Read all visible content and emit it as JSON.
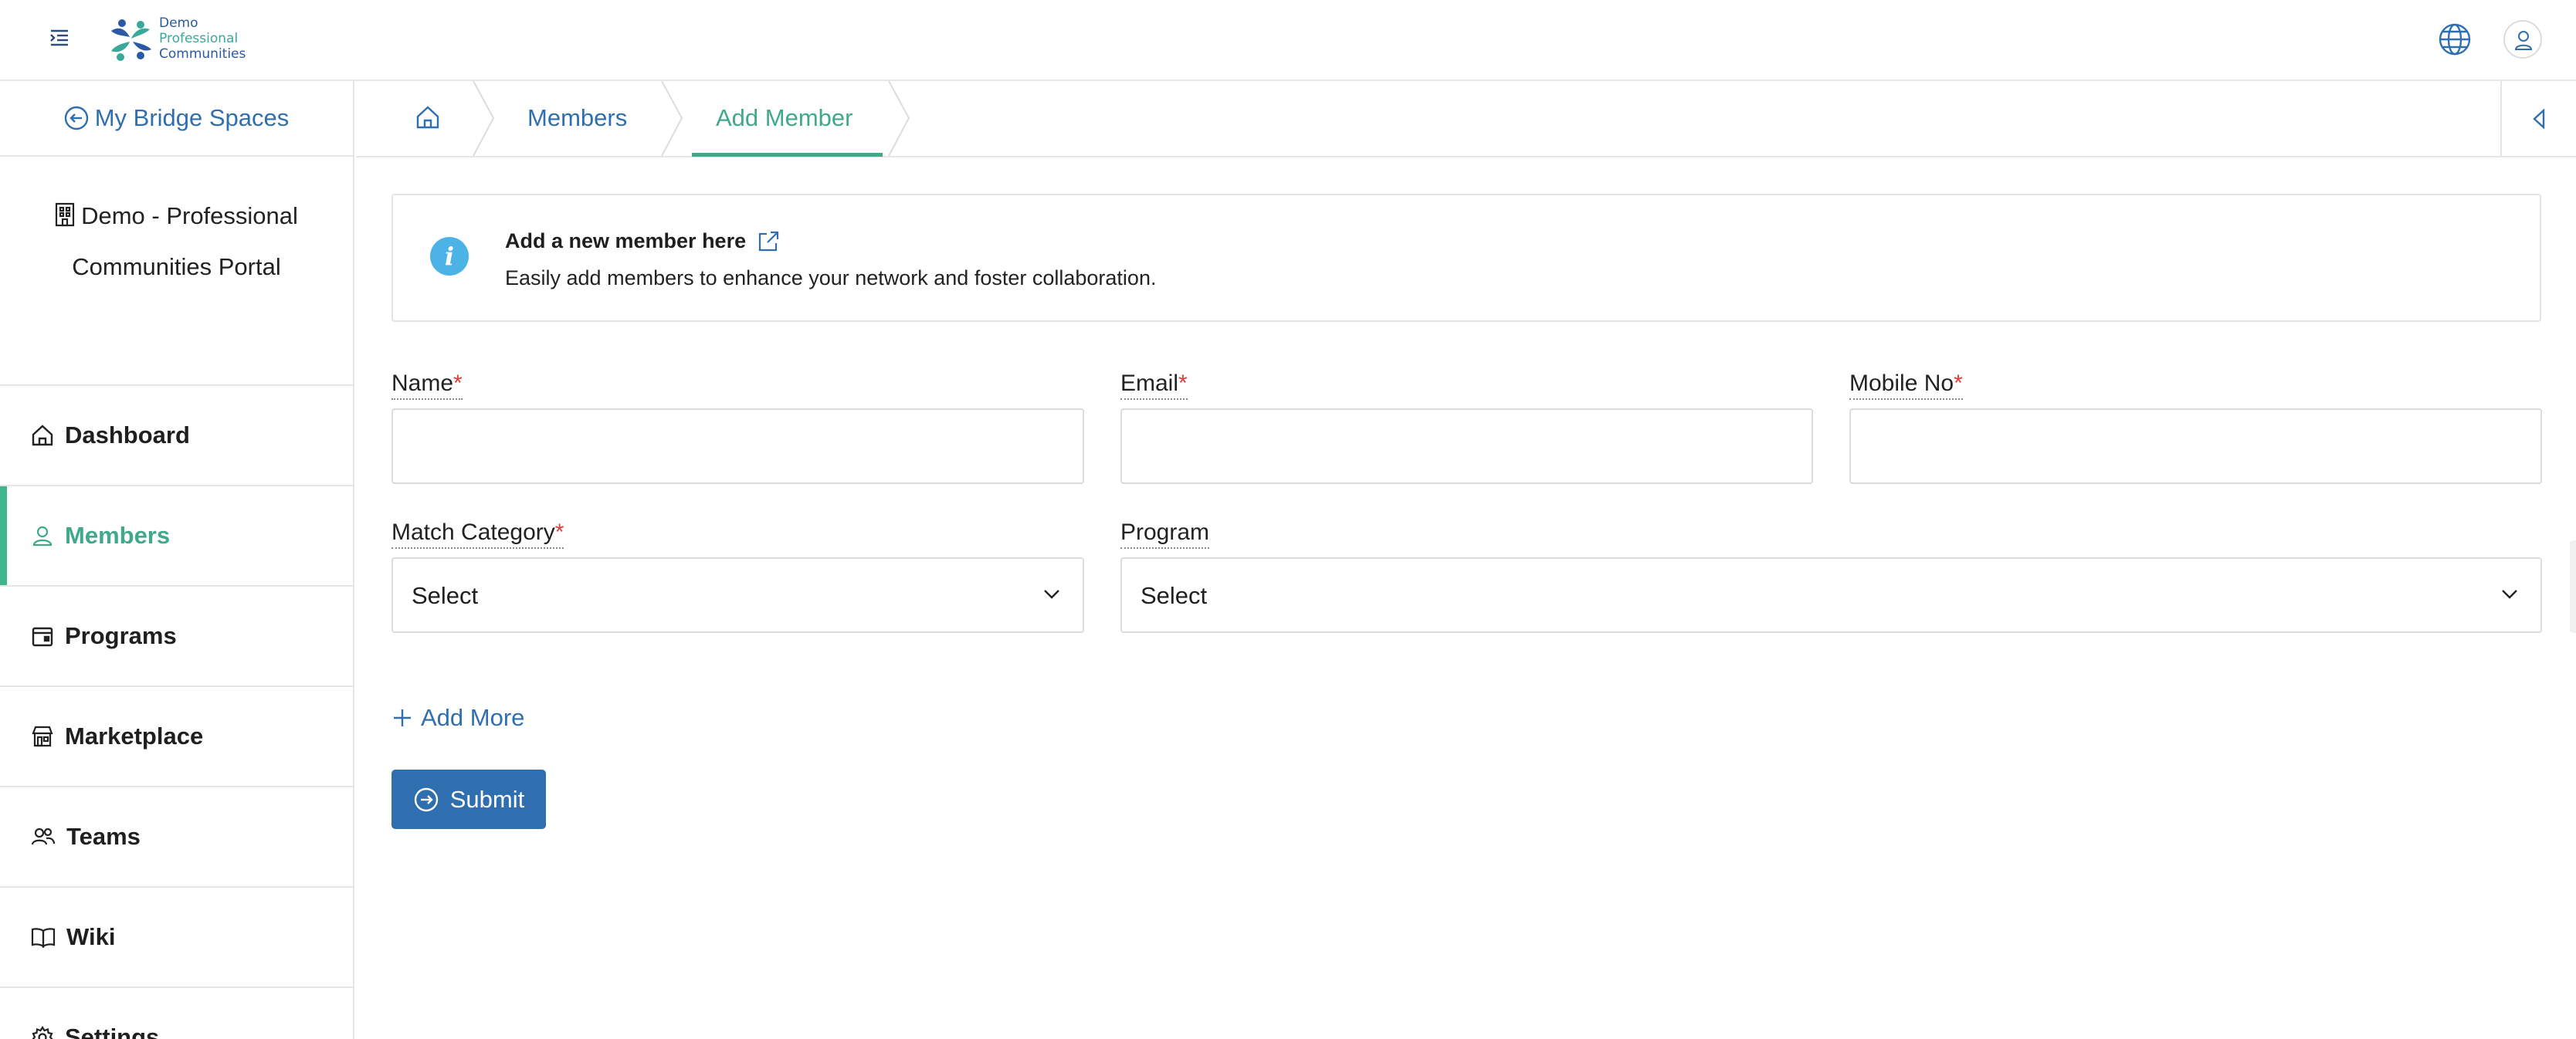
{
  "header": {
    "logo_lines": [
      "Demo",
      "Professional",
      "Communities"
    ],
    "menu_icon": "menu-indent-icon",
    "globe_icon": "globe-icon",
    "user_icon": "user-icon"
  },
  "sidebar": {
    "back_label": "My Bridge Spaces",
    "org_line1": "Demo - Professional",
    "org_line2": "Communities Portal",
    "items": [
      {
        "label": "Dashboard",
        "icon": "home-icon"
      },
      {
        "label": "Members",
        "icon": "user-icon",
        "active": true
      },
      {
        "label": "Programs",
        "icon": "calendar-icon"
      },
      {
        "label": "Marketplace",
        "icon": "store-icon"
      },
      {
        "label": "Teams",
        "icon": "team-icon"
      },
      {
        "label": "Wiki",
        "icon": "book-icon"
      },
      {
        "label": "Settings",
        "icon": "gear-icon"
      }
    ]
  },
  "breadcrumb": {
    "home_icon": "home-icon",
    "items": [
      "Members",
      "Add Member"
    ],
    "active": "Add Member"
  },
  "info": {
    "title": "Add a new member here",
    "description": "Easily add members to enhance your network and foster collaboration."
  },
  "form": {
    "name_label": "Name",
    "email_label": "Email",
    "mobile_label": "Mobile No",
    "required_mark": "*",
    "match_category_label": "Match Category",
    "program_label": "Program",
    "match_category_value": "Select",
    "program_value": "Select",
    "name_value": "",
    "email_value": "",
    "mobile_value": "",
    "add_more_label": "Add More",
    "submit_label": "Submit"
  },
  "colors": {
    "primary": "#2f6fb0",
    "accent": "#3fa98a",
    "info": "#4bb3e6",
    "required": "#e23a3a"
  }
}
